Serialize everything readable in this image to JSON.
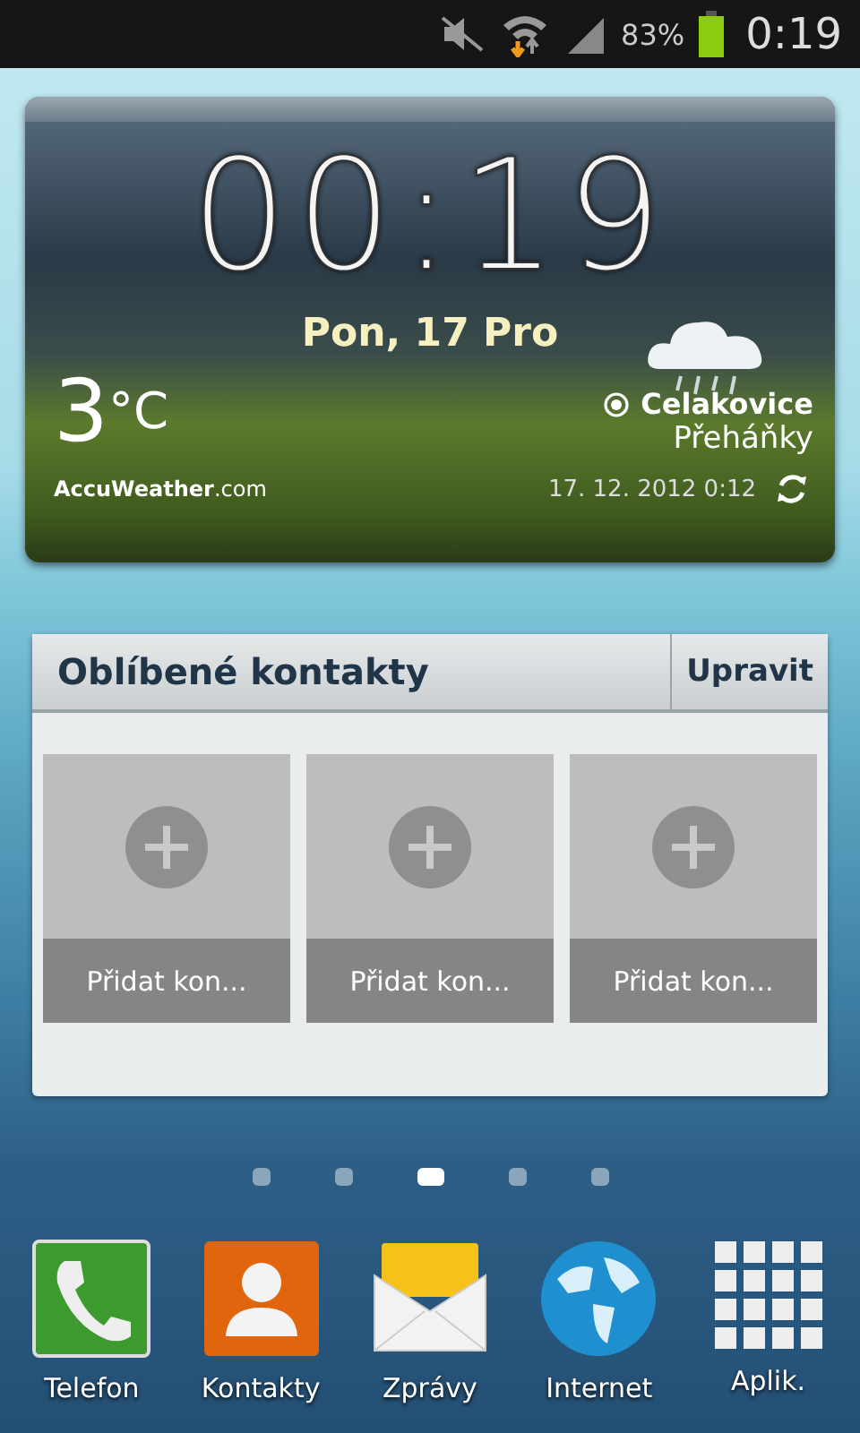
{
  "status_bar": {
    "battery": "83%",
    "time": "0:19"
  },
  "weather": {
    "clock": "00:19",
    "date": "Pon, 17 Pro",
    "temperature": "3",
    "unit": "°C",
    "provider": "AccuWeather",
    "provider_suffix": ".com",
    "location": "Celakovice",
    "condition": "Přeháňky",
    "updated": "17. 12. 2012 0:12"
  },
  "favorites": {
    "title": "Oblíbené kontakty",
    "edit": "Upravit",
    "slots": [
      "Přidat kon...",
      "Přidat kon...",
      "Přidat kon..."
    ]
  },
  "pages": [
    {
      "selected": false
    },
    {
      "selected": false
    },
    {
      "selected": true
    },
    {
      "selected": false
    },
    {
      "selected": false
    }
  ],
  "dock": [
    {
      "kind": "phone",
      "label": "Telefon"
    },
    {
      "kind": "contacts",
      "label": "Kontakty"
    },
    {
      "kind": "messages",
      "label": "Zprávy"
    },
    {
      "kind": "internet",
      "label": "Internet"
    },
    {
      "kind": "apps",
      "label": "Aplik."
    }
  ]
}
